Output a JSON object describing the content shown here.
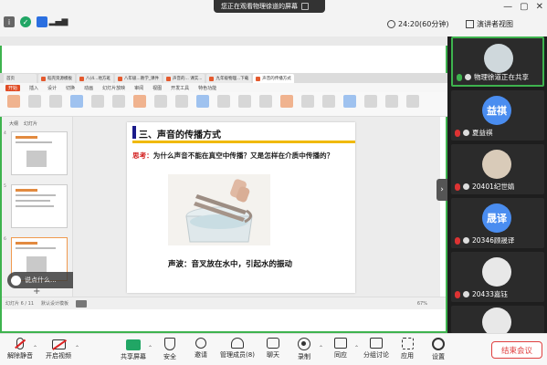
{
  "share_banner": {
    "text": "您正在观看物理徐道的屏幕"
  },
  "topbar": {
    "duration": "24:20(60分钟)",
    "view_mode": "演讲者视图"
  },
  "wps": {
    "tabs": [
      "首页",
      "稻壳资源模板",
      "八(4...地方班",
      "八年级...教学_课件",
      "声音的... 课实...",
      "九年级物理...下载",
      "声音的传播方式"
    ],
    "menu": [
      "开始",
      "插入",
      "设计",
      "切换",
      "动画",
      "幻灯片放映",
      "审阅",
      "视图",
      "开发工具",
      "特色功能"
    ],
    "menu_highlight": "开始",
    "thumb_tabs": [
      "大纲",
      "幻灯片"
    ],
    "slide_numbers": [
      "4",
      "5",
      "6"
    ],
    "status_left": "幻灯片 6 / 11",
    "status_theme": "默认设计模板",
    "status_zoom": "67%"
  },
  "slide": {
    "title": "三、声音的传播方式",
    "question_label": "思考：",
    "question_text": "为什么声音不能在真空中传播？又是怎样在介质中传播的？",
    "caption": "声波：音叉放在水中，引起水的振动"
  },
  "comment_pill": {
    "text": "说点什么..."
  },
  "participants": [
    {
      "name": "物理徐道正在共享",
      "avatar_text": "",
      "avatar_color": "#cfd8dc",
      "mic": "green",
      "speaking": true
    },
    {
      "name": "夏益祺",
      "avatar_text": "益祺",
      "avatar_color": "#4a8df0",
      "mic": "muted",
      "speaking": false
    },
    {
      "name": "20401纪世婧",
      "avatar_text": "",
      "avatar_color": "#d9cbb9",
      "mic": "muted",
      "speaking": false
    },
    {
      "name": "20346顾晟译",
      "avatar_text": "晟译",
      "avatar_color": "#4a8df0",
      "mic": "muted",
      "speaking": false
    },
    {
      "name": "20433嘉钰",
      "avatar_text": "",
      "avatar_color": "#e8e8e8",
      "mic": "muted",
      "speaking": false
    }
  ],
  "toolbar": {
    "unmute": "解除静音",
    "video": "开启视频",
    "share": "共享屏幕",
    "security": "安全",
    "invite": "邀请",
    "members": "管理成员(8)",
    "chat": "聊天",
    "record": "录制",
    "caption": "同应",
    "breakout": "分组讨论",
    "apps": "应用",
    "settings": "设置",
    "end": "结束会议"
  }
}
